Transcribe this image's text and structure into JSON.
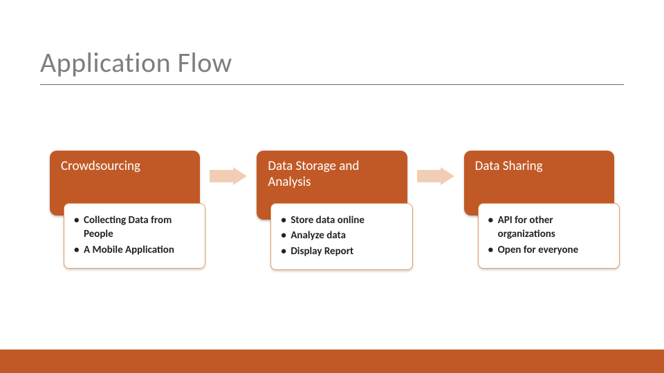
{
  "title": "Application Flow",
  "colors": {
    "accent": "#c15927",
    "accent_light": "#f2cdb6",
    "box_border": "#e69b5d",
    "title_gray": "#7d7d7d"
  },
  "stages": [
    {
      "label": "Crowdsourcing",
      "bullets": [
        "Collecting Data from People",
        "A Mobile Application"
      ]
    },
    {
      "label": "Data Storage and Analysis",
      "bullets": [
        "Store data online",
        "Analyze data",
        "Display Report"
      ]
    },
    {
      "label": "Data Sharing",
      "bullets": [
        "API for other organizations",
        "Open for everyone"
      ]
    }
  ]
}
